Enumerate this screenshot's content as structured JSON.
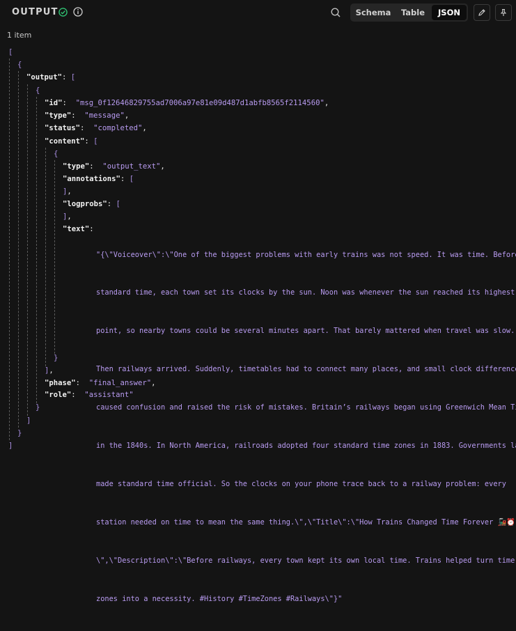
{
  "header": {
    "title": "OUTPUT",
    "tabs": [
      {
        "label": "Schema",
        "active": false
      },
      {
        "label": "Table",
        "active": false
      },
      {
        "label": "JSON",
        "active": true
      }
    ],
    "accent_ok": "#2fbf71"
  },
  "item_count": "1 item",
  "json": {
    "open_bracket": "[",
    "close_bracket": "]",
    "open_brace": "{",
    "close_brace": "}",
    "output_key": "\"output\"",
    "id_key": "\"id\"",
    "id_value": "\"msg_0f12646829755ad7006a97e81e09d487d1abfb8565f2114560\"",
    "type_key": "\"type\"",
    "type_value": "\"message\"",
    "status_key": "\"status\"",
    "status_value": "\"completed\"",
    "content_key": "\"content\"",
    "inner_type_key": "\"type\"",
    "inner_type_value": "\"output_text\"",
    "annotations_key": "\"annotations\"",
    "logprobs_key": "\"logprobs\"",
    "text_key": "\"text\"",
    "text_lines": [
      "\"{\\\"Voiceover\\\":\\\"One of the biggest problems with early trains was not speed. It was time. Before",
      "standard time, each town set its clocks by the sun. Noon was whenever the sun reached its highest",
      "point, so nearby towns could be several minutes apart. That barely mattered when travel was slow.",
      "Then railways arrived. Suddenly, timetables had to connect many places, and small clock differences",
      "caused confusion and raised the risk of mistakes. Britain’s railways began using Greenwich Mean Time",
      "in the 1840s. In North America, railroads adopted four standard time zones in 1883. Governments later",
      "made standard time official. So the clocks on your phone trace back to a railway problem: every",
      "station needed on time to mean the same thing.\\\",\\\"Title\\\":\\\"How Trains Changed Time Forever 🚂⏰",
      "\\\",\\\"Description\\\":\\\"Before railways, every town kept its own local time. Trains helped turn time",
      "zones into a necessity. #History #TimeZones #Railways\\\"}\""
    ],
    "phase_key": "\"phase\"",
    "phase_value": "\"final_answer\"",
    "role_key": "\"role\"",
    "role_value": "\"assistant\""
  }
}
